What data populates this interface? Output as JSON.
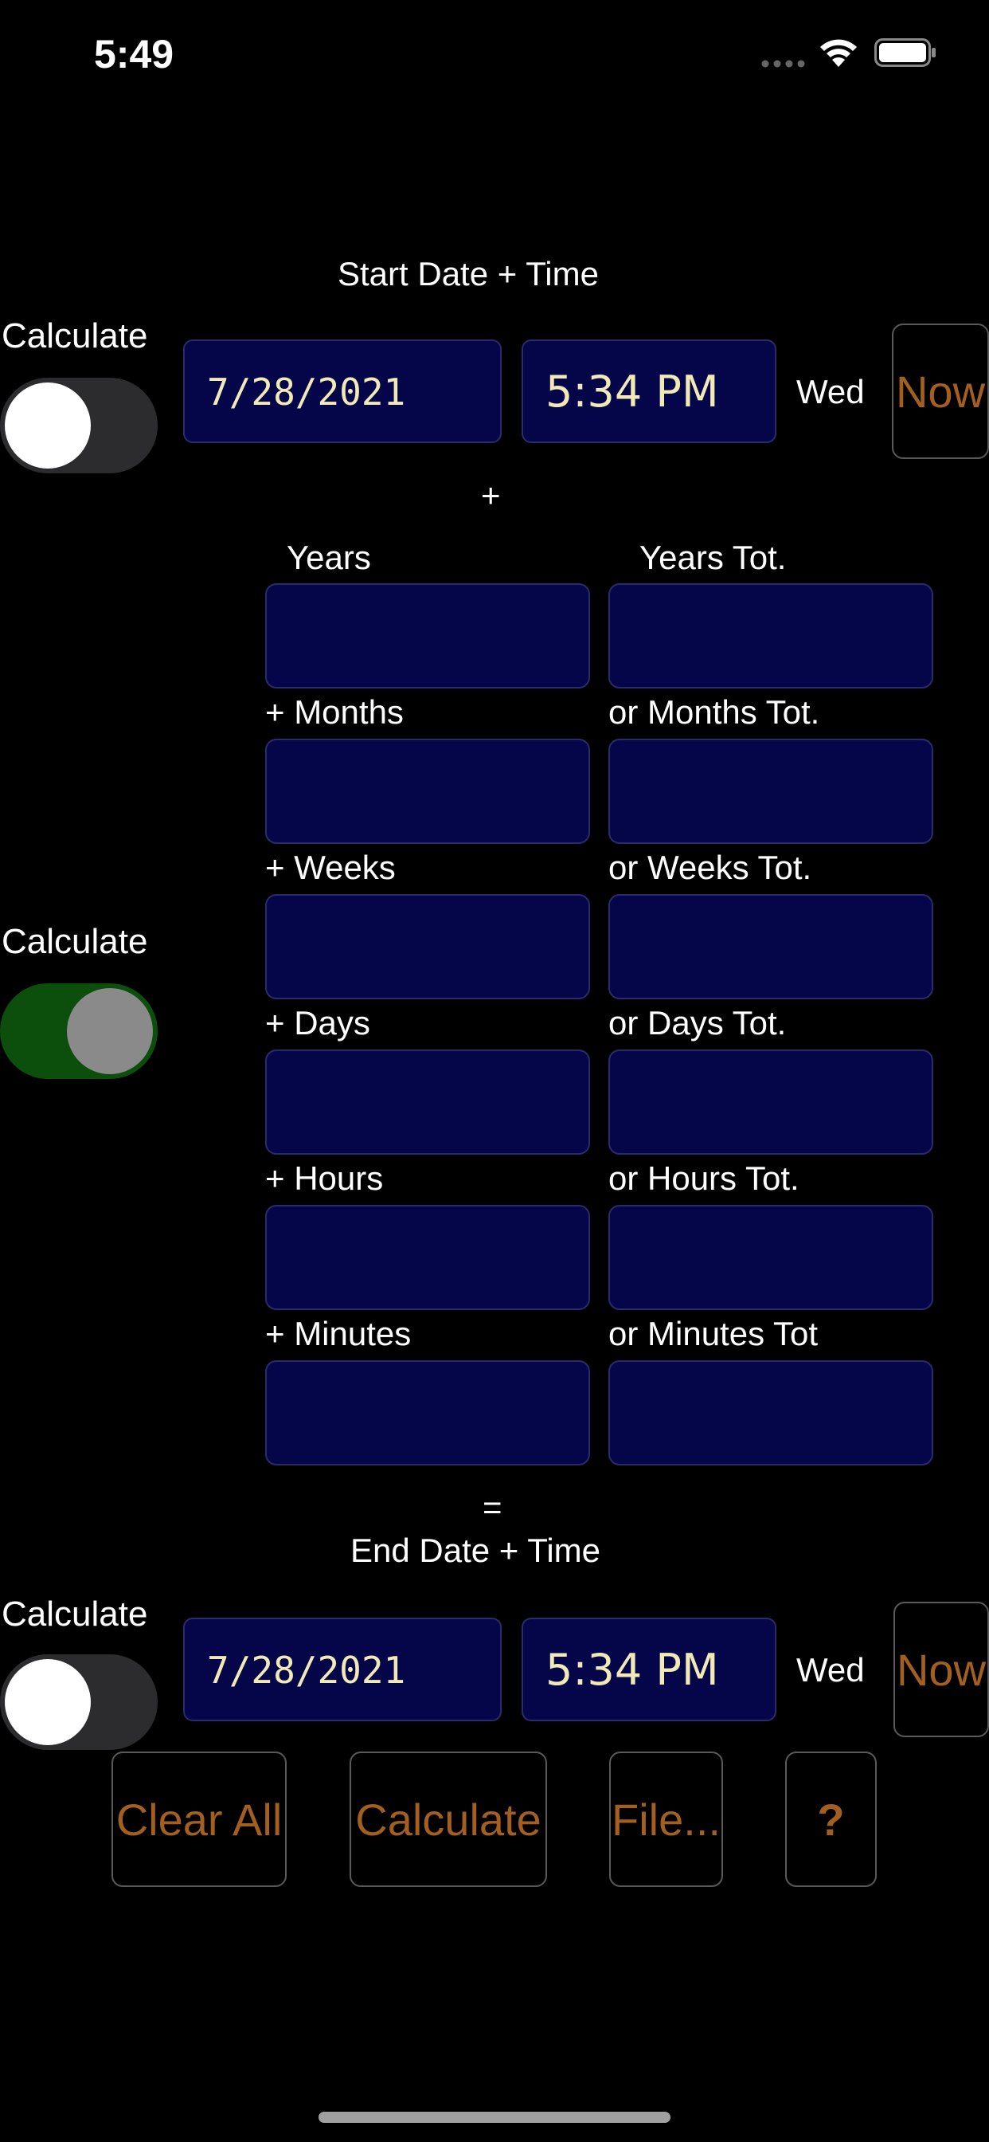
{
  "status_bar": {
    "time": "5:49",
    "dots": "....",
    "wifi_icon": "wifi-icon",
    "battery_icon": "battery-icon"
  },
  "start": {
    "title": "Start Date + Time",
    "calculate_label": "Calculate",
    "toggle_on": false,
    "date": "7/28/2021",
    "time": "5:34 PM",
    "weekday": "Wed",
    "now_label": "Now"
  },
  "plus_sign": "+",
  "columns": {
    "left_header": "Years",
    "right_header": "Years Tot."
  },
  "rows": [
    {
      "left_label": "+ Months",
      "right_label": "or Months Tot."
    },
    {
      "left_label": "+ Weeks",
      "right_label": "or Weeks Tot."
    },
    {
      "left_label": "+ Days",
      "right_label": "or Days Tot."
    },
    {
      "left_label": "+ Hours",
      "right_label": "or Hours Tot."
    },
    {
      "left_label": "+ Minutes",
      "right_label": "or Minutes Tot"
    }
  ],
  "middle": {
    "calculate_label": "Calculate",
    "toggle_on": true
  },
  "equals_sign": "=",
  "end": {
    "title": "End Date + Time",
    "calculate_label": "Calculate",
    "toggle_on": false,
    "date": "7/28/2021",
    "time": "5:34 PM",
    "weekday": "Wed",
    "now_label": "Now"
  },
  "actions": {
    "clear_all": "Clear All",
    "calculate": "Calculate",
    "file": "File...",
    "help": "?"
  },
  "colors": {
    "background": "#000000",
    "field_fill": "#05064a",
    "field_text": "#f1eab7",
    "button_text": "#a35f1f",
    "toggle_on": "#0c4f0c",
    "toggle_off": "#2c2c2e"
  }
}
